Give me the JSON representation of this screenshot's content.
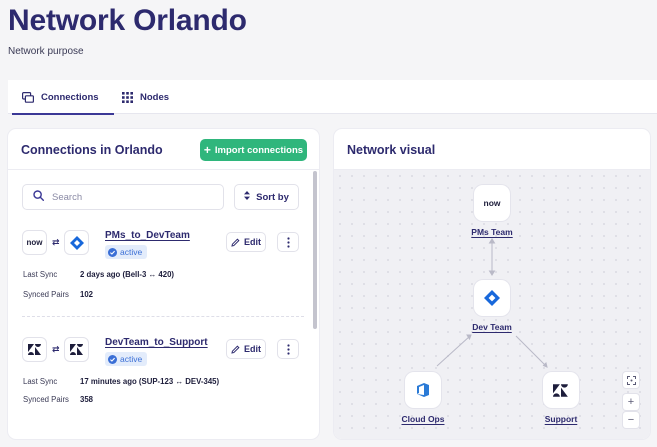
{
  "page": {
    "title": "Network Orlando",
    "subtitle": "Network purpose"
  },
  "tabs": [
    {
      "label": "Connections",
      "icon": "connections-icon",
      "active": true
    },
    {
      "label": "Nodes",
      "icon": "grid-icon",
      "active": false
    }
  ],
  "connections_panel": {
    "title": "Connections in Orlando",
    "import_button": "Import connections",
    "search_placeholder": "Search",
    "sort_button": "Sort by",
    "meta_labels": {
      "last_sync": "Last Sync",
      "synced_pairs": "Synced Pairs"
    },
    "edit_label": "Edit",
    "items": [
      {
        "name": "PMs_to_DevTeam",
        "status": "active",
        "from_logo": "servicenow-logo",
        "to_logo": "jira-logo",
        "last_sync": "2 days ago (Bell-3 ↔ 420)",
        "synced_pairs": "102"
      },
      {
        "name": "DevTeam_to_Support",
        "status": "active",
        "from_logo": "zendesk-logo",
        "to_logo": "zendesk-logo",
        "last_sync": "17 minutes ago (SUP-123 ↔ DEV-345)",
        "synced_pairs": "358"
      }
    ]
  },
  "network_panel": {
    "title": "Network visual",
    "nodes": [
      {
        "label": "PMs Team",
        "logo": "servicenow-logo",
        "logo_text": "now"
      },
      {
        "label": "Dev Team",
        "logo": "jira-logo"
      },
      {
        "label": "Cloud Ops",
        "logo": "azure-devops-logo"
      },
      {
        "label": "Support",
        "logo": "zendesk-logo"
      }
    ],
    "controls": {
      "zoom_in": "+",
      "zoom_out": "−"
    }
  },
  "colors": {
    "brand": "#2d2a6e",
    "import_button": "#2fb67c",
    "badge_bg": "#e3ecfb",
    "badge_text": "#3b6fd6",
    "jira_blue": "#1868db",
    "azure_blue": "#2a7ad6"
  }
}
